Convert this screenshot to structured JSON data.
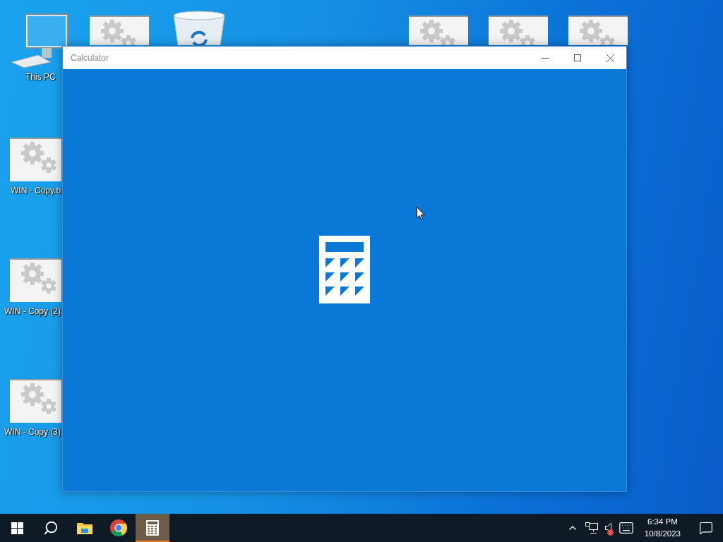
{
  "desktop_icons": [
    {
      "kind": "computer",
      "label": "This PC"
    },
    {
      "kind": "file"
    },
    {
      "kind": "recycle"
    },
    {
      "kind": "file"
    },
    {
      "kind": "file"
    },
    {
      "kind": "file"
    },
    {
      "kind": "file",
      "label": "WIN - Copy.b"
    },
    {
      "kind": "file",
      "label": "WIN - Copy (2)."
    },
    {
      "kind": "file",
      "label": "WIN - Copy (3)."
    }
  ],
  "window": {
    "title": "Calculator"
  },
  "taskbar": {
    "items": [
      {
        "kind": "start",
        "selected": false
      },
      {
        "kind": "search",
        "selected": false
      },
      {
        "kind": "explorer",
        "selected": false
      },
      {
        "kind": "browser",
        "selected": false
      },
      {
        "kind": "calculator",
        "selected": true
      }
    ],
    "tray": {
      "sound_muted": true,
      "time": "6:34 PM",
      "date": "10/8/2023"
    }
  }
}
